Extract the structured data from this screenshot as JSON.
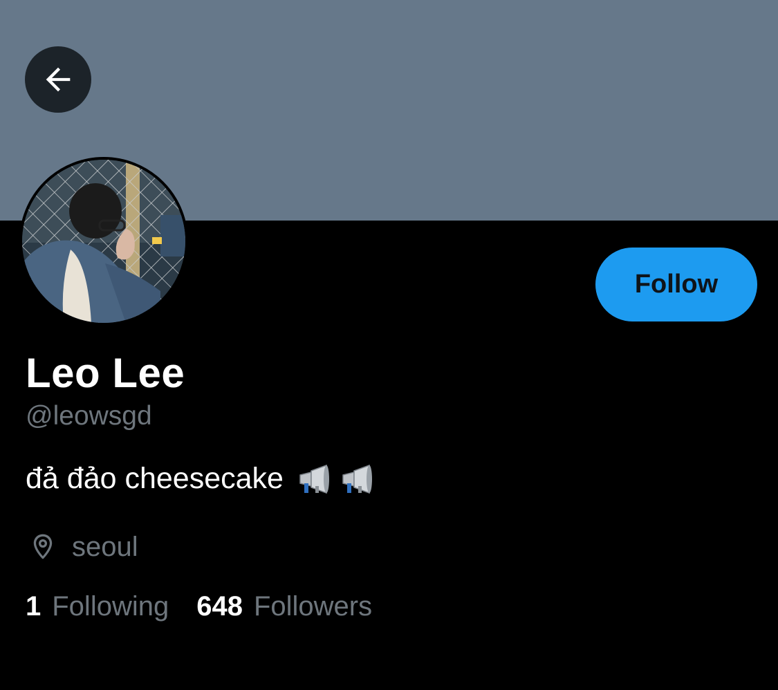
{
  "profile": {
    "name": "Leo Lee",
    "handle": "@leowsgd",
    "bio_text": "đả đảo cheesecake",
    "bio_emojis": [
      "megaphone-emoji",
      "megaphone-emoji"
    ],
    "location": "seoul",
    "following_count": "1",
    "following_label": "Following",
    "followers_count": "648",
    "followers_label": "Followers"
  },
  "actions": {
    "follow_label": "Follow"
  },
  "icons": {
    "back": "arrow-left-icon",
    "location": "map-pin-icon"
  },
  "colors": {
    "banner": "#66788a",
    "background": "#000000",
    "accent": "#1d9bf0",
    "secondary_text": "#6e767d",
    "primary_text": "#ffffff"
  }
}
